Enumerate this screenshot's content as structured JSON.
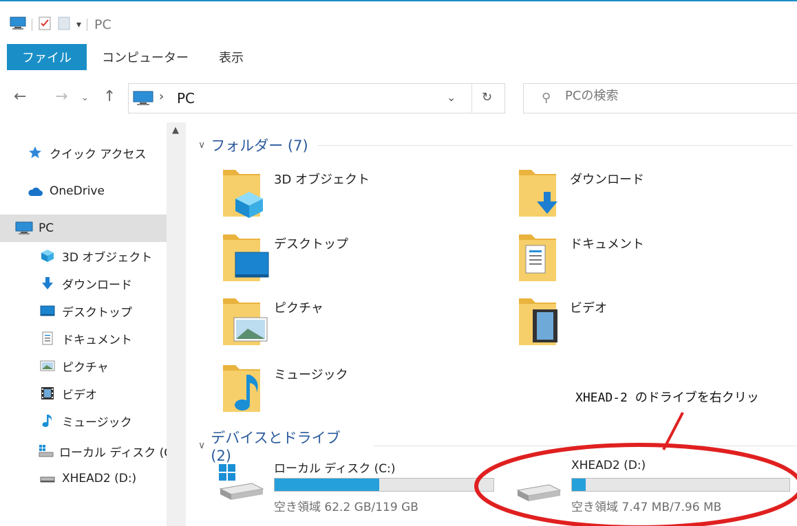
{
  "window": {
    "title": "PC"
  },
  "ribbon": {
    "tabs": [
      "ファイル",
      "コンピューター",
      "表示"
    ]
  },
  "address": {
    "location": "PC",
    "search_placeholder": "PCの検索"
  },
  "sidebar": {
    "items": [
      {
        "label": "クイック アクセス",
        "icon": "star-icon"
      },
      {
        "label": "OneDrive",
        "icon": "cloud-icon"
      },
      {
        "label": "PC",
        "icon": "pc-icon"
      },
      {
        "label": "3D オブジェクト",
        "icon": "cube-icon"
      },
      {
        "label": "ダウンロード",
        "icon": "download-icon"
      },
      {
        "label": "デスクトップ",
        "icon": "desktop-icon"
      },
      {
        "label": "ドキュメント",
        "icon": "document-icon"
      },
      {
        "label": "ピクチャ",
        "icon": "picture-icon"
      },
      {
        "label": "ビデオ",
        "icon": "video-icon"
      },
      {
        "label": "ミュージック",
        "icon": "music-icon"
      },
      {
        "label": "ローカル ディスク (C",
        "icon": "windows-drive-icon"
      },
      {
        "label": "XHEAD2 (D:)",
        "icon": "drive-icon"
      }
    ]
  },
  "folders_group": {
    "title": "フォルダー (7)"
  },
  "folders": [
    {
      "label": "3D オブジェクト",
      "overlay": "cube"
    },
    {
      "label": "ダウンロード",
      "overlay": "download"
    },
    {
      "label": "デスクトップ",
      "overlay": "desktop"
    },
    {
      "label": "ドキュメント",
      "overlay": "document"
    },
    {
      "label": "ピクチャ",
      "overlay": "picture"
    },
    {
      "label": "ビデオ",
      "overlay": "video"
    },
    {
      "label": "ミュージック",
      "overlay": "music"
    }
  ],
  "drives_group": {
    "title": "デバイスとドライブ (2)"
  },
  "drives": [
    {
      "name": "ローカル ディスク (C:)",
      "free_text": "空き領域 62.2 GB/119 GB",
      "used_fraction": 0.477
    },
    {
      "name": "XHEAD2 (D:)",
      "free_text": "空き領域 7.47 MB/7.96 MB",
      "used_fraction": 0.062
    }
  ],
  "annotation": {
    "text": "XHEAD-2 のドライブを右クリッ",
    "color": "#e02020"
  },
  "colors": {
    "accent": "#1a8fc7",
    "bar_fill": "#26a0da",
    "folder": "#f5c85a"
  }
}
